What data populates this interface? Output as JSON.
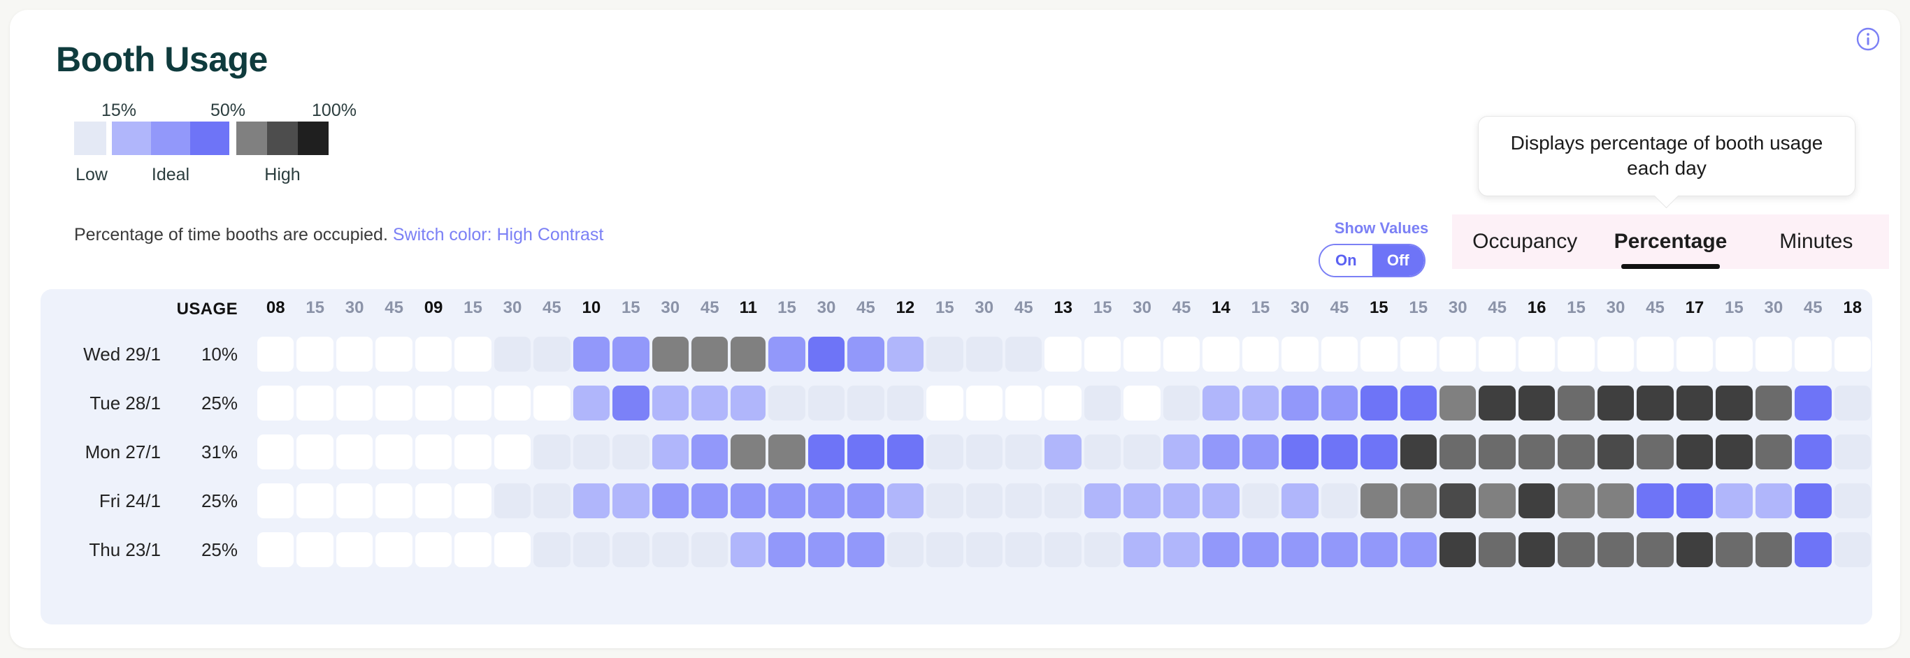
{
  "header": {
    "title": "Booth Usage",
    "info_icon": "info-circle-icon"
  },
  "tooltip": {
    "text": "Displays percentage of booth usage each day"
  },
  "legend": {
    "ticks": [
      "15%",
      "50%",
      "100%"
    ],
    "labels": [
      "Low",
      "Ideal",
      "High"
    ],
    "swatches": [
      "#e4e9f5",
      "#b0b6fb",
      "#9298fa",
      "#6e74f7",
      "#808080",
      "#4d4d4d",
      "#1f1f1f"
    ]
  },
  "caption": {
    "text": "Percentage of time booths are occupied.",
    "switch_link": "Switch color: High Contrast"
  },
  "show_values": {
    "label": "Show Values",
    "options": [
      "On",
      "Off"
    ],
    "selected": "Off"
  },
  "tabs": {
    "items": [
      "Occupancy",
      "Percentage",
      "Minutes"
    ],
    "active": "Percentage"
  },
  "chart_data": {
    "type": "heatmap",
    "title": "Booth Usage",
    "xlabel": "",
    "ylabel": "",
    "grid": false,
    "legend_position": "top-left",
    "value_unit": "percent",
    "color_scale": [
      {
        "stop": "0%",
        "color": "#ffffff",
        "band": "empty"
      },
      {
        "stop": "<15%",
        "color": "#e4e9f5",
        "band": "Low"
      },
      {
        "stop": "15%",
        "color": "#b0b6fb",
        "band": "Ideal"
      },
      {
        "stop": "30%",
        "color": "#9298fa",
        "band": "Ideal"
      },
      {
        "stop": "50%",
        "color": "#6e74f7",
        "band": "Ideal"
      },
      {
        "stop": "65%",
        "color": "#808080",
        "band": "High"
      },
      {
        "stop": "80%",
        "color": "#4d4d4d",
        "band": "High"
      },
      {
        "stop": "100%",
        "color": "#1f1f1f",
        "band": "High"
      }
    ],
    "usage_header": "USAGE",
    "columns": [
      "08",
      "15",
      "30",
      "45",
      "09",
      "15",
      "30",
      "45",
      "10",
      "15",
      "30",
      "45",
      "11",
      "15",
      "30",
      "45",
      "12",
      "15",
      "30",
      "45",
      "13",
      "15",
      "30",
      "45",
      "14",
      "15",
      "30",
      "45",
      "15",
      "15",
      "30",
      "45",
      "16",
      "15",
      "30",
      "45",
      "17",
      "15",
      "30",
      "45",
      "18"
    ],
    "column_is_hour": [
      true,
      false,
      false,
      false,
      true,
      false,
      false,
      false,
      true,
      false,
      false,
      false,
      true,
      false,
      false,
      false,
      true,
      false,
      false,
      false,
      true,
      false,
      false,
      false,
      true,
      false,
      false,
      false,
      true,
      false,
      false,
      false,
      true,
      false,
      false,
      false,
      true,
      false,
      false,
      false,
      true
    ],
    "rows": [
      {
        "day": "Wed 29/1",
        "usage": "10%",
        "cells": [
          "#ffffff",
          "#ffffff",
          "#ffffff",
          "#ffffff",
          "#ffffff",
          "#ffffff",
          "#e4e9f5",
          "#e4e9f5",
          "#9298fa",
          "#9298fa",
          "#808080",
          "#808080",
          "#808080",
          "#9298fa",
          "#6e74f7",
          "#9298fa",
          "#b0b6fb",
          "#e4e9f5",
          "#e4e9f5",
          "#e4e9f5",
          "#ffffff",
          "#ffffff",
          "#ffffff",
          "#ffffff",
          "#ffffff",
          "#ffffff",
          "#ffffff",
          "#ffffff",
          "#ffffff",
          "#ffffff",
          "#ffffff",
          "#ffffff",
          "#ffffff",
          "#ffffff",
          "#ffffff",
          "#ffffff",
          "#ffffff",
          "#ffffff",
          "#ffffff",
          "#ffffff",
          "#ffffff"
        ]
      },
      {
        "day": "Tue 28/1",
        "usage": "25%",
        "cells": [
          "#ffffff",
          "#ffffff",
          "#ffffff",
          "#ffffff",
          "#ffffff",
          "#ffffff",
          "#ffffff",
          "#ffffff",
          "#b0b6fb",
          "#7b81f8",
          "#b0b6fb",
          "#b0b6fb",
          "#b0b6fb",
          "#e4e9f5",
          "#e4e9f5",
          "#e4e9f5",
          "#e4e9f5",
          "#ffffff",
          "#ffffff",
          "#ffffff",
          "#ffffff",
          "#e4e9f5",
          "#ffffff",
          "#e4e9f5",
          "#b0b6fb",
          "#b0b6fb",
          "#9298fa",
          "#9298fa",
          "#6e74f7",
          "#6e74f7",
          "#808080",
          "#3f3f3f",
          "#3f3f3f",
          "#6b6b6b",
          "#3f3f3f",
          "#3f3f3f",
          "#3f3f3f",
          "#3f3f3f",
          "#6b6b6b",
          "#6e74f7",
          "#e4e9f5"
        ]
      },
      {
        "day": "Mon 27/1",
        "usage": "31%",
        "cells": [
          "#ffffff",
          "#ffffff",
          "#ffffff",
          "#ffffff",
          "#ffffff",
          "#ffffff",
          "#ffffff",
          "#e4e9f5",
          "#e4e9f5",
          "#e4e9f5",
          "#b0b6fb",
          "#9298fa",
          "#808080",
          "#808080",
          "#6e74f7",
          "#6e74f7",
          "#6e74f7",
          "#e4e9f5",
          "#e4e9f5",
          "#e4e9f5",
          "#b0b6fb",
          "#e4e9f5",
          "#e4e9f5",
          "#b0b6fb",
          "#9298fa",
          "#9298fa",
          "#6e74f7",
          "#6e74f7",
          "#6e74f7",
          "#3f3f3f",
          "#6b6b6b",
          "#6b6b6b",
          "#6b6b6b",
          "#6b6b6b",
          "#4a4a4a",
          "#6b6b6b",
          "#3f3f3f",
          "#3f3f3f",
          "#6b6b6b",
          "#6e74f7",
          "#e4e9f5"
        ]
      },
      {
        "day": "Fri 24/1",
        "usage": "25%",
        "cells": [
          "#ffffff",
          "#ffffff",
          "#ffffff",
          "#ffffff",
          "#ffffff",
          "#ffffff",
          "#e4e9f5",
          "#e4e9f5",
          "#b0b6fb",
          "#b0b6fb",
          "#9298fa",
          "#9298fa",
          "#9298fa",
          "#9298fa",
          "#9298fa",
          "#9298fa",
          "#b0b6fb",
          "#e4e9f5",
          "#e4e9f5",
          "#e4e9f5",
          "#e4e9f5",
          "#b0b6fb",
          "#b0b6fb",
          "#b0b6fb",
          "#b0b6fb",
          "#e4e9f5",
          "#b0b6fb",
          "#e4e9f5",
          "#808080",
          "#808080",
          "#4a4a4a",
          "#808080",
          "#3f3f3f",
          "#808080",
          "#808080",
          "#6e74f7",
          "#6e74f7",
          "#b0b6fb",
          "#b0b6fb",
          "#6e74f7",
          "#e4e9f5"
        ]
      },
      {
        "day": "Thu 23/1",
        "usage": "25%",
        "cells": [
          "#ffffff",
          "#ffffff",
          "#ffffff",
          "#ffffff",
          "#ffffff",
          "#ffffff",
          "#ffffff",
          "#e4e9f5",
          "#e4e9f5",
          "#e4e9f5",
          "#e4e9f5",
          "#e4e9f5",
          "#b0b6fb",
          "#9298fa",
          "#9298fa",
          "#9298fa",
          "#e4e9f5",
          "#e4e9f5",
          "#e4e9f5",
          "#e4e9f5",
          "#e4e9f5",
          "#e4e9f5",
          "#b0b6fb",
          "#b0b6fb",
          "#9298fa",
          "#9298fa",
          "#9298fa",
          "#9298fa",
          "#9298fa",
          "#9298fa",
          "#3f3f3f",
          "#6b6b6b",
          "#3f3f3f",
          "#6b6b6b",
          "#6b6b6b",
          "#6b6b6b",
          "#3f3f3f",
          "#6b6b6b",
          "#6b6b6b",
          "#6e74f7",
          "#e4e9f5"
        ]
      }
    ]
  }
}
